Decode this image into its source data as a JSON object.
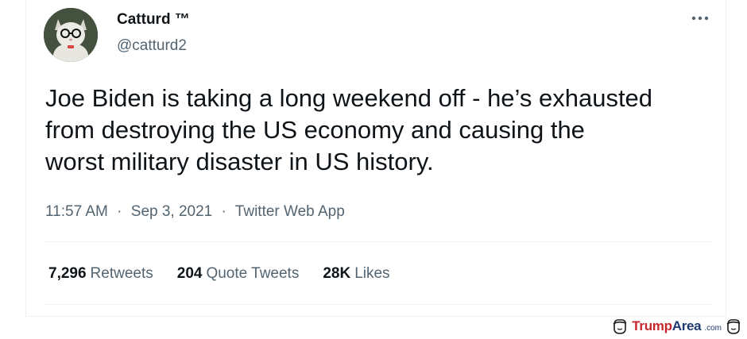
{
  "tweet": {
    "display_name": "Catturd ™",
    "handle": "@catturd2",
    "text": "Joe Biden is taking a long weekend off - he’s exhausted\nfrom destroying the US economy and causing the\nworst military disaster in US history.",
    "time": "11:57 AM",
    "date": "Sep 3, 2021",
    "source": "Twitter Web App",
    "separator": "·",
    "more_icon": "more-horizontal-icon",
    "stats": [
      {
        "count": "7,296",
        "label": "Retweets"
      },
      {
        "count": "204",
        "label": "Quote Tweets"
      },
      {
        "count": "28K",
        "label": "Likes"
      }
    ]
  },
  "watermark": {
    "brand_part1": "Trump",
    "brand_part2": "Area",
    "tld": ".com",
    "icon": "trump-head-icon"
  },
  "colors": {
    "text_primary": "#0f1419",
    "text_secondary": "#536471",
    "divider": "#eff3f4",
    "watermark_red": "#c8262d",
    "watermark_blue": "#1f3a6e"
  }
}
